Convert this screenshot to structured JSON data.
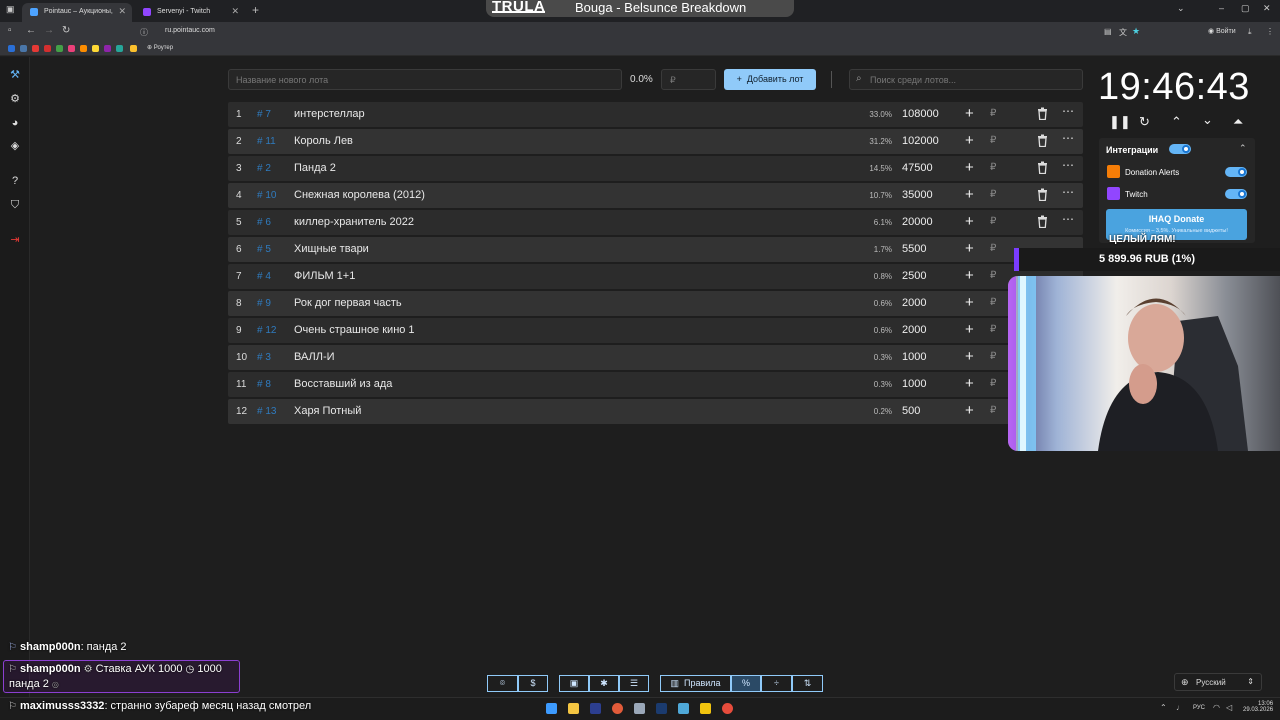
{
  "browser": {
    "tabs": [
      {
        "label": "Pointauc – Аукционы, лотереи",
        "favicon_color": "#4da3ff"
      },
      {
        "label": "Servenyi - Twitch",
        "favicon_color": "#9146ff"
      }
    ],
    "url": "ru.pointauc.com",
    "bookmark_router": "Роутер",
    "login_label": "Войти"
  },
  "stream_title": {
    "brand": "TRULA",
    "song": "Bouga - Belsunce Breakdown"
  },
  "sidebar_icons": [
    "gavel-icon",
    "gear-icon",
    "wheel-icon",
    "layers-icon",
    "help-icon",
    "shield-icon",
    "logout-icon"
  ],
  "toolbar": {
    "new_lot_placeholder": "Название нового лота",
    "new_lot_pct": "0.0%",
    "amount_placeholder": "₽",
    "add_lot_label": "Добавить лот",
    "search_placeholder": "Поиск среди лотов..."
  },
  "lots": [
    {
      "idx": "1",
      "fid": "# 7",
      "name": "интерстеллар",
      "pct": "33.0%",
      "amount": "108000",
      "deletable": true
    },
    {
      "idx": "2",
      "fid": "# 11",
      "name": "Король Лев",
      "pct": "31.2%",
      "amount": "102000",
      "deletable": true
    },
    {
      "idx": "3",
      "fid": "# 2",
      "name": "Панда 2",
      "pct": "14.5%",
      "amount": "47500",
      "deletable": true
    },
    {
      "idx": "4",
      "fid": "# 10",
      "name": "Снежная королева (2012)",
      "pct": "10.7%",
      "amount": "35000",
      "deletable": true
    },
    {
      "idx": "5",
      "fid": "# 6",
      "name": "киллер-хранитель 2022",
      "pct": "6.1%",
      "amount": "20000",
      "deletable": true
    },
    {
      "idx": "6",
      "fid": "# 5",
      "name": "Хищные твари",
      "pct": "1.7%",
      "amount": "5500",
      "deletable": false
    },
    {
      "idx": "7",
      "fid": "# 4",
      "name": "ФИЛЬМ 1+1",
      "pct": "0.8%",
      "amount": "2500",
      "deletable": false
    },
    {
      "idx": "8",
      "fid": "# 9",
      "name": "Рок дог первая часть",
      "pct": "0.6%",
      "amount": "2000",
      "deletable": false
    },
    {
      "idx": "9",
      "fid": "# 12",
      "name": "Очень страшное кино 1",
      "pct": "0.6%",
      "amount": "2000",
      "deletable": false
    },
    {
      "idx": "10",
      "fid": "# 3",
      "name": "ВАЛЛ-И",
      "pct": "0.3%",
      "amount": "1000",
      "deletable": false
    },
    {
      "idx": "11",
      "fid": "# 8",
      "name": "Восставший из ада",
      "pct": "0.3%",
      "amount": "1000",
      "deletable": false
    },
    {
      "idx": "12",
      "fid": "# 13",
      "name": "Харя Потный",
      "pct": "0.2%",
      "amount": "500",
      "deletable": false
    }
  ],
  "timer": {
    "value": "19:46:43"
  },
  "integrations": {
    "title": "Интеграции",
    "items": [
      {
        "label": "Donation Alerts",
        "icon": "donationalerts-icon",
        "color": "#f57d07"
      },
      {
        "label": "Twitch",
        "icon": "twitch-icon",
        "color": "#9146ff"
      }
    ],
    "donate_label": "IHAQ Donate",
    "donate_sub": "Комиссия – 3,5%. Уникальные виджеты!"
  },
  "goal": {
    "title": "ЦЕЛЫЙ ЛЯМ!",
    "text": "5 899.96 RUB (1%)",
    "progress": 0.01
  },
  "chat": [
    {
      "user": "shamp000n",
      "text": ": панда 2"
    },
    {
      "user": "shamp000n",
      "bid_label": "Ставка АУК 1000",
      "bid_amount": "1000",
      "lot": "панда 2"
    },
    {
      "user": "maximusss3332",
      "text": ": странно зубареф месяц назад смотрел"
    }
  ],
  "bottom": {
    "rules_label": "Правила",
    "language": "Русский"
  },
  "taskbar": {
    "lang": "РУС",
    "time": "13:06",
    "date": "29.03.2026"
  },
  "colors": {
    "accent": "#90caf9",
    "lot_id": "#2f7bbf",
    "goal": "#7a3cff"
  }
}
